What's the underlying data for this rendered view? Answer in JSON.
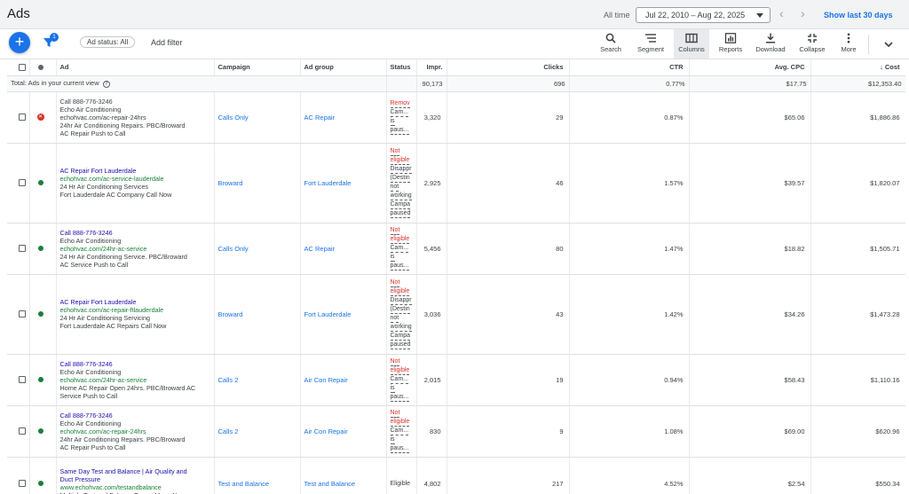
{
  "header": {
    "title": "Ads",
    "all_time_label": "All time",
    "date_range": "Jul 22, 2010 – Aug 22, 2025",
    "show_last": "Show last 30 days"
  },
  "toolbar": {
    "filter_badge": "1",
    "chip_label": "Ad status: All",
    "add_filter": "Add filter",
    "tools": {
      "search": "Search",
      "segment": "Segment",
      "columns": "Columns",
      "reports": "Reports",
      "download": "Download",
      "collapse": "Collapse",
      "more": "More"
    }
  },
  "table": {
    "columns": {
      "ad": "Ad",
      "campaign": "Campaign",
      "ad_group": "Ad group",
      "status": "Status",
      "impr": "Impr.",
      "clicks": "Clicks",
      "ctr": "CTR",
      "avg_cpc": "Avg. CPC",
      "cost": "Cost"
    },
    "total": {
      "label": "Total: Ads in your current view",
      "impr": "90,173",
      "clicks": "696",
      "ctr": "0.77%",
      "avg_cpc": "$17.75",
      "cost": "$12,353.40"
    },
    "rows": [
      {
        "state": "removed",
        "headline": "Call 888-776-3246",
        "headline_plain": true,
        "lines": [
          "Echo Air Conditioning",
          "echohvac.com/ac-repair-24hrs",
          "24hr Air Conditioning Repairs. PBC/Broward",
          "AC Repair Push to Call"
        ],
        "url_plain": true,
        "campaign": "Calls Only",
        "ad_group": "AC Repair",
        "status_lines": [
          "Remov",
          "Cam...",
          "is",
          "paus..."
        ],
        "impr": "3,320",
        "clicks": "29",
        "ctr": "0.87%",
        "avg_cpc": "$65.06",
        "cost": "$1,886.86"
      },
      {
        "state": "green",
        "headline": "AC Repair Fort Lauderdale",
        "lines": [
          "echohvac.com/ac-service-lauderdale",
          "24 Hr Air Conditioning Services",
          "Fort Lauderdale AC Company Call Now"
        ],
        "url_index": 0,
        "campaign": "Broward",
        "ad_group": "Fort Lauderdale",
        "status_lines": [
          "Not",
          "eligible",
          "Disappr",
          "(Destin",
          "not",
          "working",
          "Campa",
          "paused"
        ],
        "impr": "2,925",
        "clicks": "46",
        "ctr": "1.57%",
        "avg_cpc": "$39.57",
        "cost": "$1,820.07"
      },
      {
        "state": "green",
        "headline": "Call 888-776-3246",
        "lines": [
          "Echo Air Conditioning",
          "echohvac.com/24hr-ac-service",
          "24 Hr Air Conditioning Service. PBC/Broward",
          "AC Service Push to Call"
        ],
        "url_index": 1,
        "campaign": "Calls Only",
        "ad_group": "AC Repair",
        "status_lines": [
          "Not",
          "eligible",
          "Cam...",
          "is",
          "paus..."
        ],
        "impr": "5,456",
        "clicks": "80",
        "ctr": "1.47%",
        "avg_cpc": "$18.82",
        "cost": "$1,505.71"
      },
      {
        "state": "green",
        "headline": "AC Repair Fort Lauderdale",
        "lines": [
          "echohvac.com/ac-repair-ftlauderdale",
          "24 Hr Air Conditioning Servicing",
          "Fort Lauderdale AC Repairs Call Now"
        ],
        "url_index": 0,
        "campaign": "Broward",
        "ad_group": "Fort Lauderdale",
        "status_lines": [
          "Not",
          "eligible",
          "Disappr",
          "(Destin",
          "not",
          "working",
          "Campa",
          "paused"
        ],
        "impr": "3,036",
        "clicks": "43",
        "ctr": "1.42%",
        "avg_cpc": "$34.26",
        "cost": "$1,473.28"
      },
      {
        "state": "green",
        "headline": "Call 888-776-3246",
        "lines": [
          "Echo Air Conditioning",
          "echohvac.com/24hr-ac-service",
          "Home AC Repair Open 24hrs. PBC/Broward AC",
          "Service Push to Call"
        ],
        "url_index": 1,
        "campaign": "Calls 2",
        "ad_group": "Air Con Repair",
        "status_lines": [
          "Not",
          "eligible",
          "Cam...",
          "is",
          "paus..."
        ],
        "impr": "2,015",
        "clicks": "19",
        "ctr": "0.94%",
        "avg_cpc": "$58.43",
        "cost": "$1,110.16"
      },
      {
        "state": "green",
        "headline": "Call 888-776-3246",
        "lines": [
          "Echo Air Conditioning",
          "echohvac.com/ac-repair-24hrs",
          "24hr Air Conditioning Repairs. PBC/Broward",
          "AC Repair Push to Call"
        ],
        "url_index": 1,
        "campaign": "Calls 2",
        "ad_group": "Air Con Repair",
        "status_lines": [
          "Not",
          "eligible",
          "Cam...",
          "is",
          "paus..."
        ],
        "impr": "830",
        "clicks": "9",
        "ctr": "1.08%",
        "avg_cpc": "$69.00",
        "cost": "$620.96"
      },
      {
        "state": "green",
        "headline": "Same Day Test and Balance | Air Quality and",
        "lines": [
          "Duct Pressure",
          "www.echohvac.com/testandbalance",
          "Multiple Test and Balance Teams Mean No"
        ],
        "url_index": 1,
        "headline_cont": true,
        "campaign": "Test and Balance",
        "ad_group": "Test and Balance",
        "status_lines": [
          "Eligible"
        ],
        "impr": "4,802",
        "clicks": "217",
        "ctr": "4.52%",
        "avg_cpc": "$2.54",
        "cost": "$550.34"
      }
    ]
  },
  "colors": {
    "accent": "#1a73e8",
    "green": "#188038",
    "red": "#d93025"
  }
}
